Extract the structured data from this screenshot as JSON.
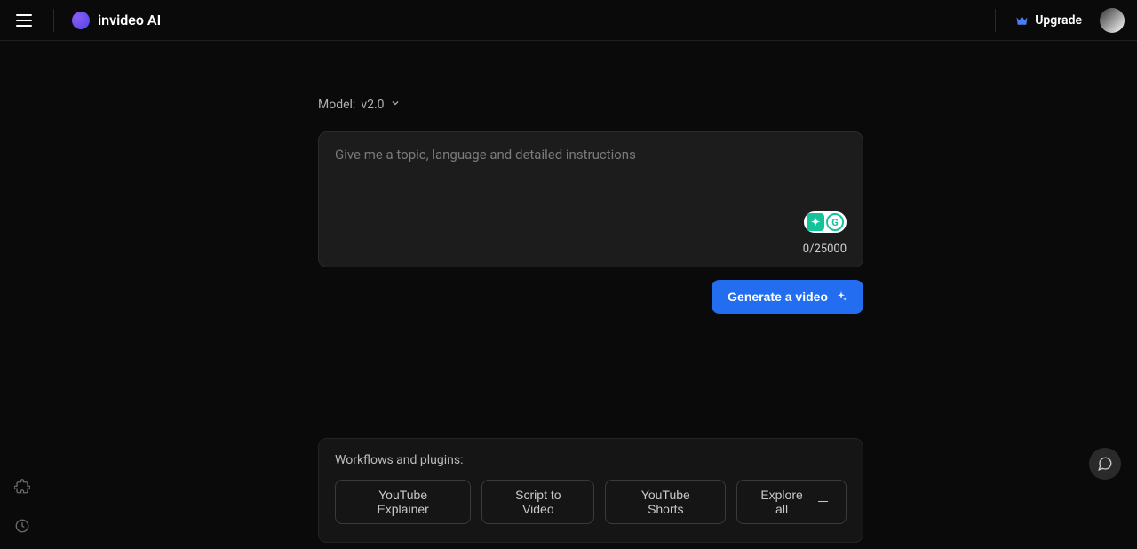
{
  "header": {
    "brand": "invideo AI",
    "upgrade_label": "Upgrade"
  },
  "model_selector": {
    "prefix": "Model: ",
    "value": "v2.0"
  },
  "prompt": {
    "placeholder": "Give me a topic, language and detailed instructions",
    "value": "",
    "char_count": "0/25000"
  },
  "generate_button_label": "Generate a video",
  "workflows": {
    "title": "Workflows and plugins:",
    "chips": [
      "YouTube Explainer",
      "Script to Video",
      "YouTube Shorts"
    ],
    "explore_label": "Explore all"
  },
  "icons": {
    "hamburger": "hamburger-icon",
    "logo": "logo-icon",
    "crown": "crown-icon",
    "avatar": "avatar",
    "chevron_down": "chevron-down-icon",
    "sparkle": "sparkle-icon",
    "plus": "plus-icon",
    "puzzle": "puzzle-icon",
    "history": "history-icon",
    "chat": "chat-icon",
    "grammarly": "grammarly-icon"
  }
}
